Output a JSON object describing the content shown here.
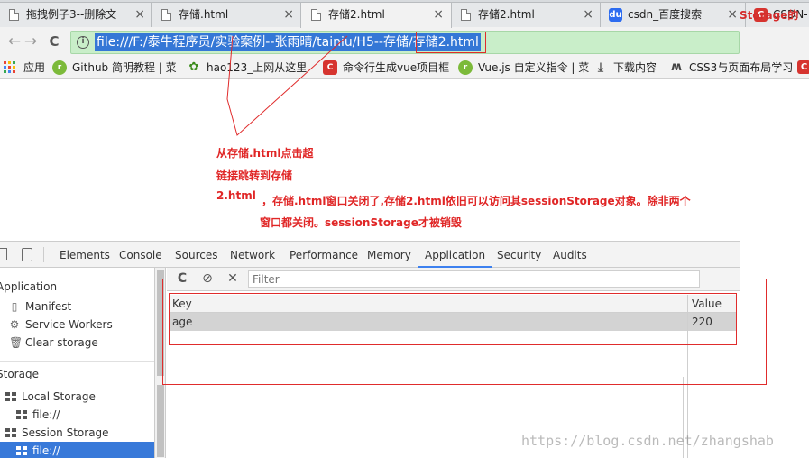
{
  "tabs": [
    {
      "title": "拖拽例子3--删除文",
      "active": false
    },
    {
      "title": "存储.html",
      "active": false
    },
    {
      "title": "存储2.html",
      "active": true
    },
    {
      "title": "存储2.html",
      "active": false
    },
    {
      "title": "csdn_百度搜索",
      "active": false
    },
    {
      "title": "CSDN-",
      "active": false
    }
  ],
  "tab_close_glyph": "×",
  "toolbar": {
    "back_icon": "←",
    "forward_icon": "→",
    "reload_icon": "C",
    "info_icon": "i",
    "url": "file:///F:/泰牛程序员/实验案例--张雨晴/tainiu/H5--存储/存储2.html",
    "right_partial": "Storage的"
  },
  "bookmarks": [
    {
      "label": "应用",
      "icon": "apps-icon"
    },
    {
      "label": "Github 简明教程 | 菜",
      "icon": "runoob-icon"
    },
    {
      "label": "hao123_上网从这里",
      "icon": "hao123-icon"
    },
    {
      "label": "命令行生成vue项目框",
      "icon": "csdn-icon"
    },
    {
      "label": "Vue.js 自定义指令 | 菜",
      "icon": "runoob-icon"
    },
    {
      "label": "下载内容",
      "icon": "download-icon"
    },
    {
      "label": "CSS3与页面布局学习",
      "icon": "css-icon"
    }
  ],
  "annotation": {
    "line1": "从存储.html点击超",
    "line2": "链接跳转到存储",
    "line3": "2.html",
    "note1": "，存储.html窗口关闭了,存储2.html依旧可以访问其sessionStorage对象。除非两个",
    "note2": "窗口都关闭。sessionStorage才被销毁",
    "color": "#e02626"
  },
  "devtools": {
    "tabs": [
      "Elements",
      "Console",
      "Sources",
      "Network",
      "Performance",
      "Memory",
      "Application",
      "Security",
      "Audits"
    ],
    "active_tab": "Application",
    "sidebar": {
      "application_header": "Application",
      "items": [
        {
          "label": "Manifest",
          "icon": "document-icon"
        },
        {
          "label": "Service Workers",
          "icon": "gear-icon"
        },
        {
          "label": "Clear storage",
          "icon": "trash-icon"
        }
      ],
      "storage_header": "Storage",
      "storage_items": [
        {
          "label": "Local Storage",
          "indent": 0,
          "selected": false
        },
        {
          "label": "file://",
          "indent": 1,
          "selected": false
        },
        {
          "label": "Session Storage",
          "indent": 0,
          "selected": false
        },
        {
          "label": "file://",
          "indent": 1,
          "selected": true
        }
      ]
    },
    "main": {
      "refresh_icon": "C",
      "clear_icon": "⊘",
      "delete_icon": "✕",
      "filter_placeholder": "Filter",
      "columns": [
        "Key",
        "Value"
      ],
      "rows": [
        {
          "key": "age",
          "value": "220"
        }
      ]
    }
  },
  "watermark": "https://blog.csdn.net/zhangshab",
  "colors": {
    "accent_blue": "#3879d9",
    "highlight_red": "#e02c2c",
    "omnibox_green": "#c9eec9"
  }
}
